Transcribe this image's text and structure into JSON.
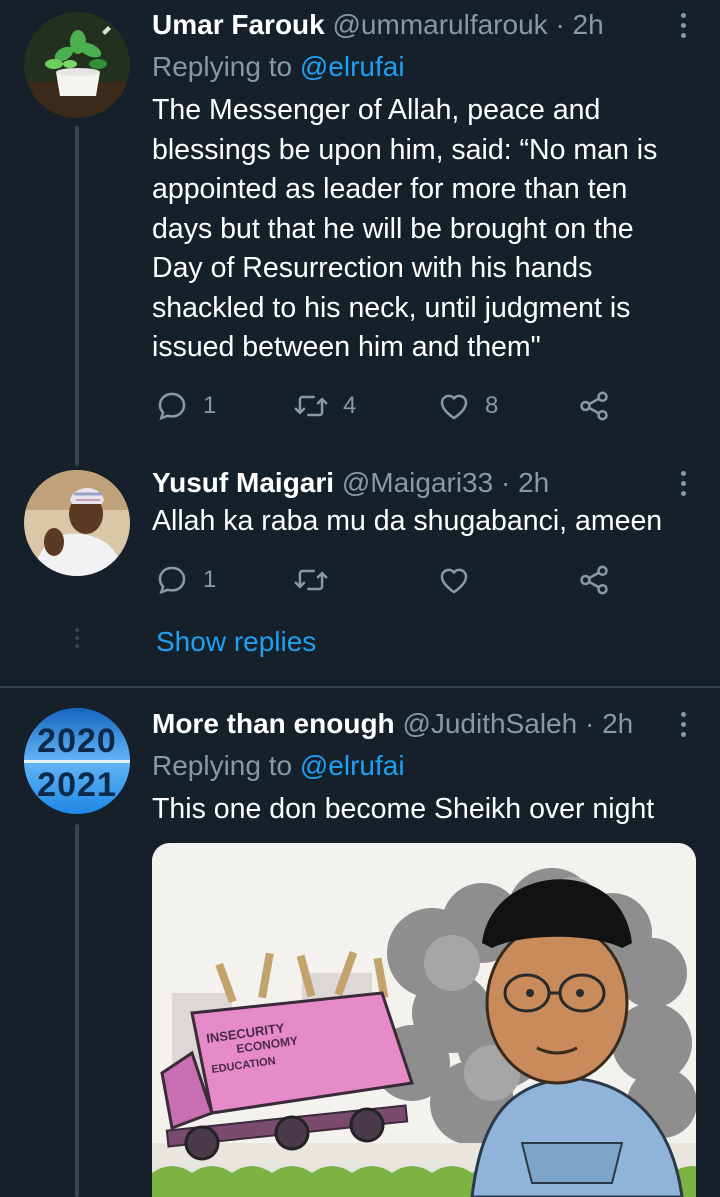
{
  "tweets": [
    {
      "name": "Umar Farouk",
      "handle": "@ummarulfarouk",
      "dot": "·",
      "time": "2h",
      "replying_prefix": "Replying to ",
      "replying_to": "@elrufai",
      "text": "The Messenger of Allah, peace and blessings be upon him, said: “No man is appointed as leader for more than ten days but that he will be brought on the Day of Resurrection with his hands shackled to his neck, until judgment is issued between him and them\"",
      "replies": "1",
      "retweets": "4",
      "likes": "8"
    },
    {
      "name": "Yusuf Maigari",
      "handle": "@Maigari33",
      "dot": "·",
      "time": "2h",
      "text": "Allah ka raba mu da shugabanci, ameen",
      "replies": "1",
      "retweets": "",
      "likes": ""
    },
    {
      "name": "More than enough",
      "handle": "@JudithSaleh",
      "dot": "·",
      "time": "2h",
      "replying_prefix": "Replying to ",
      "replying_to": "@elrufai",
      "text": "This one don become Sheikh over night",
      "avatar_text": [
        "2020",
        "2021"
      ],
      "media_labels": [
        "INSECURITY",
        "ECONOMY",
        "EDUCATION"
      ]
    }
  ],
  "show_replies": "Show replies",
  "colors": {
    "background": "#15202b",
    "secondary_text": "#8899a6",
    "link": "#1da1f2",
    "divider": "#38444d"
  }
}
